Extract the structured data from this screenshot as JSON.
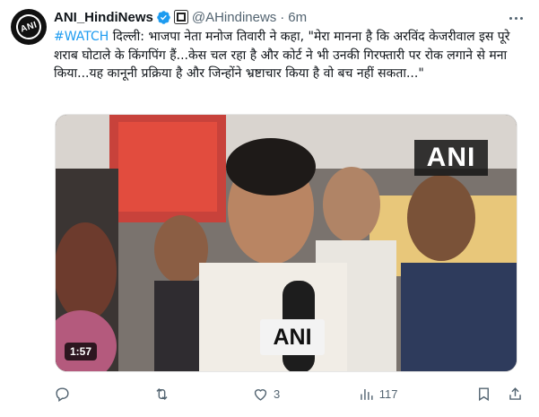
{
  "author": {
    "name": "ANI_HindiNews",
    "handle": "@AHindinews",
    "time": "6m",
    "dot": "·",
    "avatar_text": "ANI"
  },
  "tweet": {
    "hashtag": "#WATCH",
    "body": " दिल्ली: भाजपा नेता मनोज तिवारी ने कहा, \"मेरा मानना है कि अरविंद केजरीवाल इस पूरे शराब घोटाले के किंगपिंग हैं...केस चल रहा है और कोर्ट ने भी उनकी गिरफ्तारी पर रोक लगाने से मना किया...यह कानूनी प्रक्रिया है और जिन्होंने भ्रष्टाचार किया है वो बच नहीं सकता...\""
  },
  "media": {
    "duration": "1:57",
    "watermark": "ANI",
    "mic_label": "ANI"
  },
  "actions": {
    "reply_count": "",
    "retweet_count": "",
    "like_count": "3",
    "views_count": "117"
  },
  "colors": {
    "accent": "#1d9bf0",
    "muted": "#536471",
    "text": "#0f1419"
  }
}
